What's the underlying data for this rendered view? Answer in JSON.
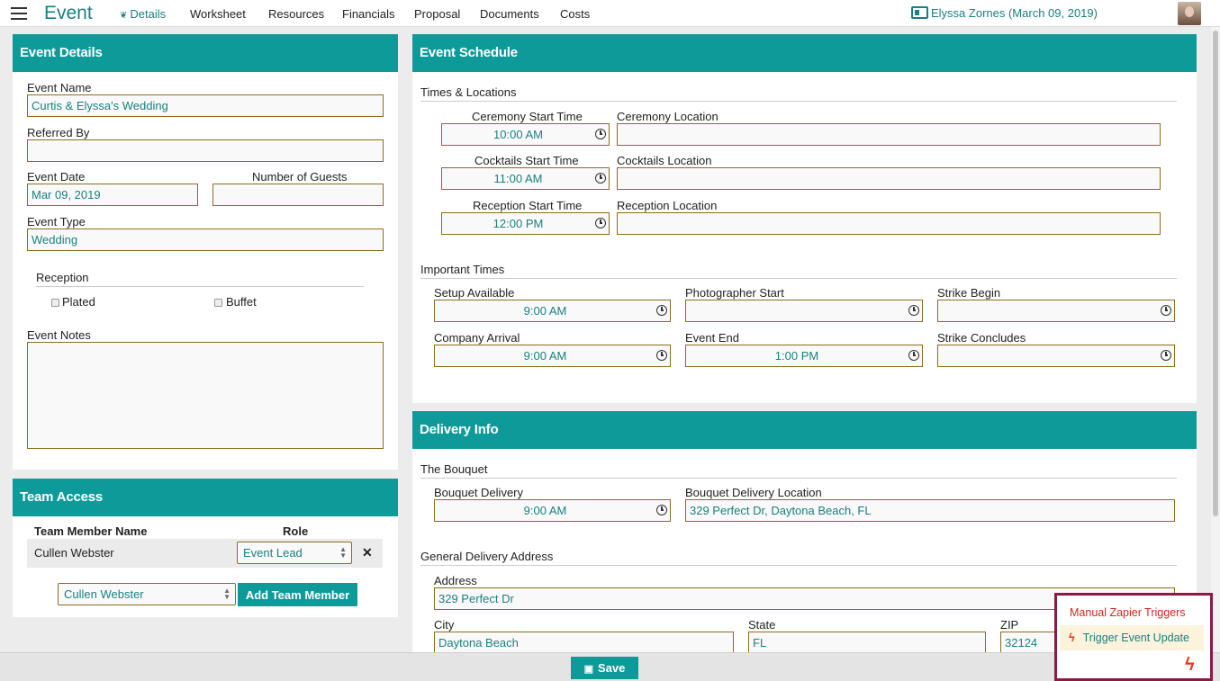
{
  "header": {
    "app_title": "Event",
    "tabs": [
      "Details",
      "Worksheet",
      "Resources",
      "Financials",
      "Proposal",
      "Documents",
      "Costs"
    ],
    "active_tab": "Details",
    "user_link": "Elyssa Zornes (March 09, 2019)"
  },
  "event_details": {
    "title": "Event Details",
    "event_name_label": "Event Name",
    "event_name": "Curtis & Elyssa's Wedding",
    "referred_by_label": "Referred By",
    "referred_by": "",
    "event_date_label": "Event Date",
    "event_date": "Mar 09, 2019",
    "guests_label": "Number of Guests",
    "guests": "",
    "event_type_label": "Event Type",
    "event_type": "Wedding",
    "reception_label": "Reception",
    "plated_label": "Plated",
    "buffet_label": "Buffet",
    "notes_label": "Event Notes"
  },
  "team_access": {
    "title": "Team Access",
    "col_name": "Team Member Name",
    "col_role": "Role",
    "rows": [
      {
        "name": "Cullen Webster",
        "role": "Event Lead"
      }
    ],
    "remove_symbol": "✕",
    "add_select": "Cullen Webster",
    "add_button": "Add Team Member"
  },
  "schedule": {
    "title": "Event Schedule",
    "times_locations_label": "Times & Locations",
    "ceremony_time_label": "Ceremony Start Time",
    "ceremony_time": "10:00 AM",
    "ceremony_location_label": "Ceremony Location",
    "cocktails_time_label": "Cocktails Start Time",
    "cocktails_time": "11:00 AM",
    "cocktails_location_label": "Cocktails Location",
    "reception_time_label": "Reception Start Time",
    "reception_time": "12:00 PM",
    "reception_location_label": "Reception Location",
    "important_times_label": "Important Times",
    "setup_label": "Setup Available",
    "setup": "9:00 AM",
    "photographer_label": "Photographer Start",
    "photographer": "",
    "strike_begin_label": "Strike Begin",
    "strike_begin": "",
    "company_arrival_label": "Company Arrival",
    "company_arrival": "9:00 AM",
    "event_end_label": "Event End",
    "event_end": "1:00 PM",
    "strike_concludes_label": "Strike Concludes",
    "strike_concludes": ""
  },
  "delivery": {
    "title": "Delivery Info",
    "bouquet_label": "The Bouquet",
    "bouquet_delivery_label": "Bouquet Delivery",
    "bouquet_delivery": "9:00 AM",
    "bouquet_location_label": "Bouquet Delivery Location",
    "bouquet_location": "329 Perfect Dr, Daytona Beach, FL",
    "general_label": "General Delivery Address",
    "address_label": "Address",
    "address": "329 Perfect Dr",
    "city_label": "City",
    "city": "Daytona Beach",
    "state_label": "State",
    "state": "FL",
    "zip_label": "ZIP",
    "zip": "32124"
  },
  "footer": {
    "save_label": "Save"
  },
  "zapier": {
    "title": "Manual Zapier Triggers",
    "item": "Trigger Event Update"
  }
}
